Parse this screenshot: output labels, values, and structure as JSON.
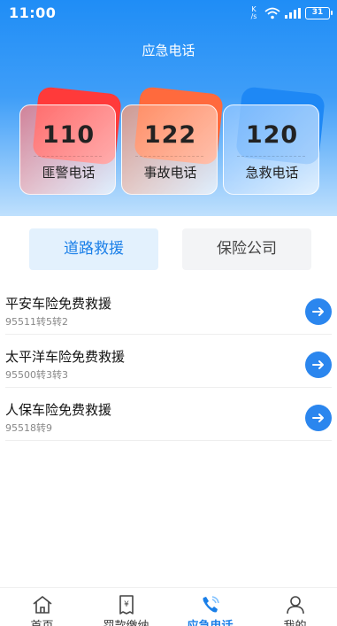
{
  "status_bar": {
    "time": "11:00",
    "net_speed_top": "K",
    "net_speed_bottom": "/s",
    "battery": "31"
  },
  "header": {
    "title": "应急电话"
  },
  "hotlines": [
    {
      "number": "110",
      "label": "匪警电话",
      "color": "#ff3a3a"
    },
    {
      "number": "122",
      "label": "事故电话",
      "color": "#ff6a3d"
    },
    {
      "number": "120",
      "label": "急救电话",
      "color": "#1e88f5"
    }
  ],
  "segments": [
    {
      "label": "道路救援",
      "active": true
    },
    {
      "label": "保险公司",
      "active": false
    }
  ],
  "rescue_list": [
    {
      "title": "平安车险免费救援",
      "phone": "95511转5转2"
    },
    {
      "title": "太平洋车险免费救援",
      "phone": "95500转3转3"
    },
    {
      "title": "人保车险免费救援",
      "phone": "95518转9"
    }
  ],
  "tabbar": [
    {
      "label": "首页",
      "icon": "home-icon"
    },
    {
      "label": "罚款缴纳",
      "icon": "receipt-icon",
      "glyph": "¥"
    },
    {
      "label": "应急电话",
      "icon": "phone-icon",
      "active": true
    },
    {
      "label": "我的",
      "icon": "user-icon"
    }
  ],
  "colors": {
    "accent": "#1a7fe8",
    "arrow_button": "#2b86ee"
  }
}
